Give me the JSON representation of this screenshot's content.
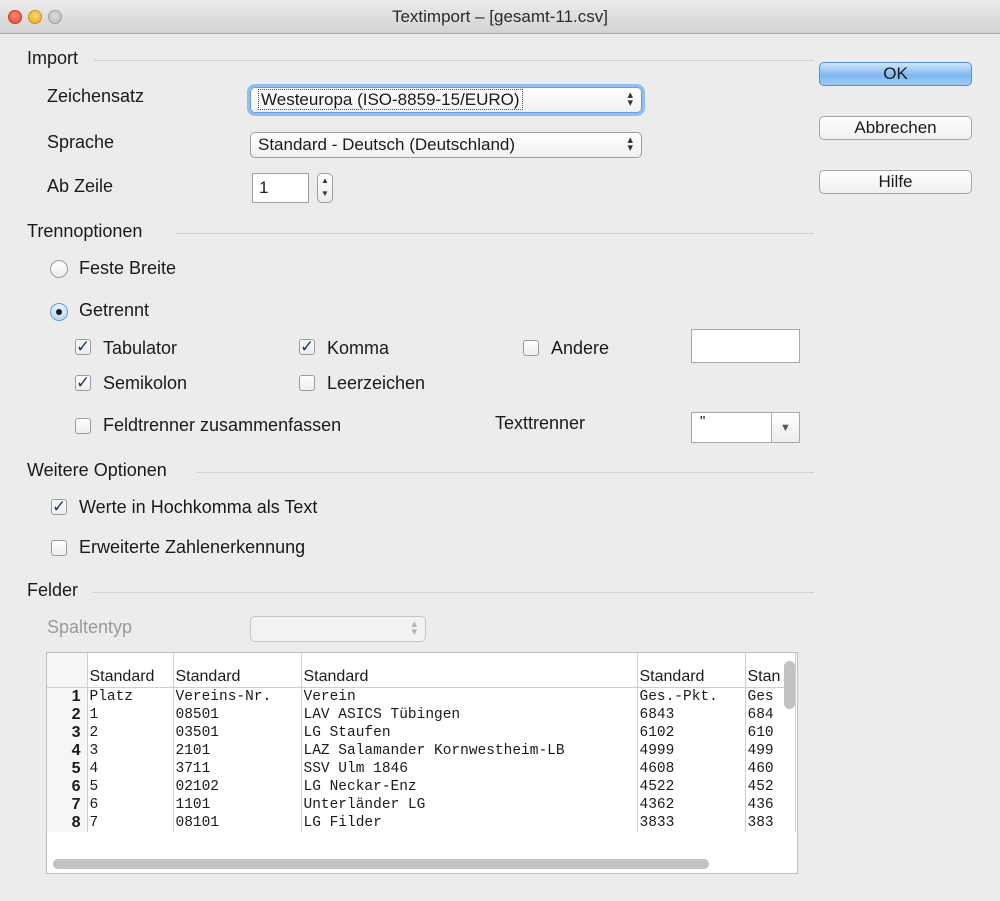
{
  "window": {
    "title": "Textimport – [gesamt-11.csv]"
  },
  "buttons": {
    "ok": "OK",
    "cancel": "Abbrechen",
    "help": "Hilfe"
  },
  "import": {
    "heading": "Import",
    "charset_label": "Zeichensatz",
    "charset_value": "Westeuropa (ISO-8859-15/EURO)",
    "language_label": "Sprache",
    "language_value": "Standard - Deutsch (Deutschland)",
    "from_row_label": "Ab Zeile",
    "from_row_value": "1"
  },
  "separator": {
    "heading": "Trennoptionen",
    "fixed_width": {
      "label": "Feste Breite",
      "selected": false
    },
    "separated": {
      "label": "Getrennt",
      "selected": true
    },
    "tab": {
      "label": "Tabulator",
      "checked": true
    },
    "comma": {
      "label": "Komma",
      "checked": true
    },
    "other": {
      "label": "Andere",
      "checked": false,
      "value": ""
    },
    "semicolon": {
      "label": "Semikolon",
      "checked": true
    },
    "space": {
      "label": "Leerzeichen",
      "checked": false
    },
    "merge": {
      "label": "Feldtrenner zusammenfassen",
      "checked": false
    },
    "text_delimiter_label": "Texttrenner",
    "text_delimiter_value": "\""
  },
  "more": {
    "heading": "Weitere Optionen",
    "quoted_as_text": {
      "label": "Werte in Hochkomma als Text",
      "checked": true
    },
    "extended_numbers": {
      "label": "Erweiterte Zahlenerkennung",
      "checked": false
    }
  },
  "fields": {
    "heading": "Felder",
    "column_type_label": "Spaltentyp",
    "column_type_value": "",
    "headers": [
      "Standard",
      "Standard",
      "Standard",
      "Standard",
      "Stan"
    ],
    "rows": [
      {
        "n": "1",
        "cells": [
          "Platz",
          "Vereins-Nr.",
          "Verein",
          "Ges.-Pkt.",
          "Ges"
        ]
      },
      {
        "n": "2",
        "cells": [
          "1",
          "08501",
          "LAV ASICS Tübingen",
          "6843",
          "684"
        ]
      },
      {
        "n": "3",
        "cells": [
          "2",
          "03501",
          "LG Staufen",
          "6102",
          "610"
        ]
      },
      {
        "n": "4",
        "cells": [
          "3",
          "2101",
          "LAZ Salamander Kornwestheim-LB",
          "4999",
          "499"
        ]
      },
      {
        "n": "5",
        "cells": [
          "4",
          "3711",
          "SSV Ulm 1846",
          "4608",
          "460"
        ]
      },
      {
        "n": "6",
        "cells": [
          "5",
          "02102",
          "LG Neckar-Enz",
          "4522",
          "452"
        ]
      },
      {
        "n": "7",
        "cells": [
          "6",
          "1101",
          "Unterländer LG",
          "4362",
          "436"
        ]
      },
      {
        "n": "8",
        "cells": [
          "7",
          "08101",
          "LG Filder",
          "3833",
          "383"
        ]
      }
    ]
  }
}
